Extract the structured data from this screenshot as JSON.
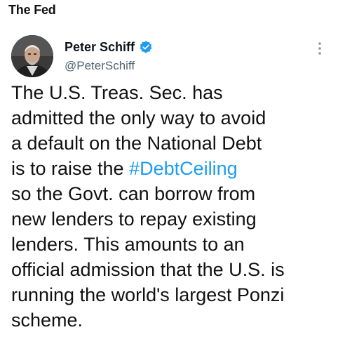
{
  "topic": {
    "label": "The Fed"
  },
  "author": {
    "display_name": "Peter Schiff",
    "handle": "@PeterSchiff",
    "verified": true,
    "verified_color": "#1d9bf0"
  },
  "menu": {
    "icon": "more-vertical-icon"
  },
  "tweet": {
    "lines": [
      {
        "text": "The U.S. Treas. Sec. has"
      },
      {
        "text": "admitted the only way to avoid"
      },
      {
        "text": "a default on the National Debt"
      },
      {
        "before": "is to raise the ",
        "hashtag": "#DebtCeiling"
      },
      {
        "text": "so the Govt. can borrow from"
      },
      {
        "text": "new lenders to repay existing"
      },
      {
        "text": "lenders. This amounts to an"
      },
      {
        "text": "official admission that the U.S. is"
      },
      {
        "text": "running the world's largest Ponzi"
      },
      {
        "text": "scheme."
      }
    ]
  },
  "colors": {
    "text": "#0f1419",
    "secondary": "#536471",
    "link": "#1d9bf0"
  }
}
